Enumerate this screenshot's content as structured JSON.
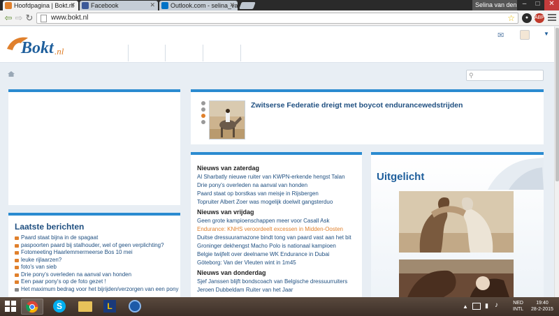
{
  "browser": {
    "tabs": [
      {
        "title": "Hoofdpagina | Bokt.nl",
        "active": true,
        "favicon_color": "#e0802c"
      },
      {
        "title": "Facebook",
        "active": false,
        "favicon_color": "#3b5998"
      },
      {
        "title": "Outlook.com - selina_van...",
        "active": false,
        "favicon_color": "#0072c6"
      }
    ],
    "user": "Selina van den...",
    "url": "www.bokt.nl",
    "extensions": [
      {
        "name": "rss-icon",
        "label": "",
        "color": "#2b2b2b"
      },
      {
        "name": "adblock-icon",
        "label": "ABP",
        "color": "#c0392b"
      }
    ]
  },
  "site": {
    "logo_text": "Bokt",
    "logo_suffix": ".nl"
  },
  "search": {
    "placeholder": ""
  },
  "feature": {
    "title": "Zwitserse Federatie dreigt met boycot endurancewedstrijden"
  },
  "news": {
    "groups": [
      {
        "heading": "Nieuws van zaterdag",
        "items": [
          {
            "text": "Al Sharbatly nieuwe ruiter van KWPN-erkende hengst Talan",
            "highlight": false
          },
          {
            "text": "Drie pony's overleden na aanval van honden",
            "highlight": false
          },
          {
            "text": "Paard staat op borstkas van meisje in Rijsbergen",
            "highlight": false
          },
          {
            "text": "Topruiter Albert Zoer was mogelijk doelwit gangsterduo",
            "highlight": false
          }
        ]
      },
      {
        "heading": "Nieuws van vrijdag",
        "items": [
          {
            "text": "Geen grote kampioenschappen meer voor Casall Ask",
            "highlight": false
          },
          {
            "text": "Endurance: KNHS veroordeelt excessen in Midden-Oosten",
            "highlight": true
          },
          {
            "text": "Duitse dressuuramazone bindt tong van paard vast aan het bit",
            "highlight": false
          },
          {
            "text": "Groninger dekhengst Macho Polo is nationaal kampioen",
            "highlight": false
          },
          {
            "text": "Belgie twijfelt over deelname WK Endurance in Dubai",
            "highlight": false
          },
          {
            "text": "Göteborg: Van der Vleuten wint in 1m45",
            "highlight": false
          }
        ]
      },
      {
        "heading": "Nieuws van donderdag",
        "items": [
          {
            "text": "Sjef Janssen blijft bondscoach van Belgische dressuurruiters",
            "highlight": false
          },
          {
            "text": "Jeroen Dubbeldam Ruiter van het Jaar",
            "highlight": false
          }
        ]
      }
    ]
  },
  "latest": {
    "title": "Laatste berichten",
    "items": [
      "Paard staat bijna in de spagaat",
      "paspoorten paard bij stalhouder, wel of geen verplichting?",
      "Fotomeeting Haarlemmermeerse Bos 10 mei",
      "leuke rijlaarzen?",
      "foto's van sieb",
      "Drie pony's overleden na aanval van honden",
      "Een paar pony's op de foto gezet !",
      "Het maximum bedrag voor het bijrijden/verzorgen van een pony"
    ]
  },
  "uitgelicht": {
    "title": "Uitgelicht"
  },
  "taskbar": {
    "apps": [
      {
        "name": "windows-start-icon"
      },
      {
        "name": "chrome-icon",
        "active": true
      },
      {
        "name": "skype-icon"
      },
      {
        "name": "file-explorer-icon"
      },
      {
        "name": "app-l-icon"
      },
      {
        "name": "media-icon"
      }
    ],
    "lang_line1": "NED",
    "lang_line2": "INTL",
    "time": "19:40",
    "date": "28-2-2015"
  }
}
